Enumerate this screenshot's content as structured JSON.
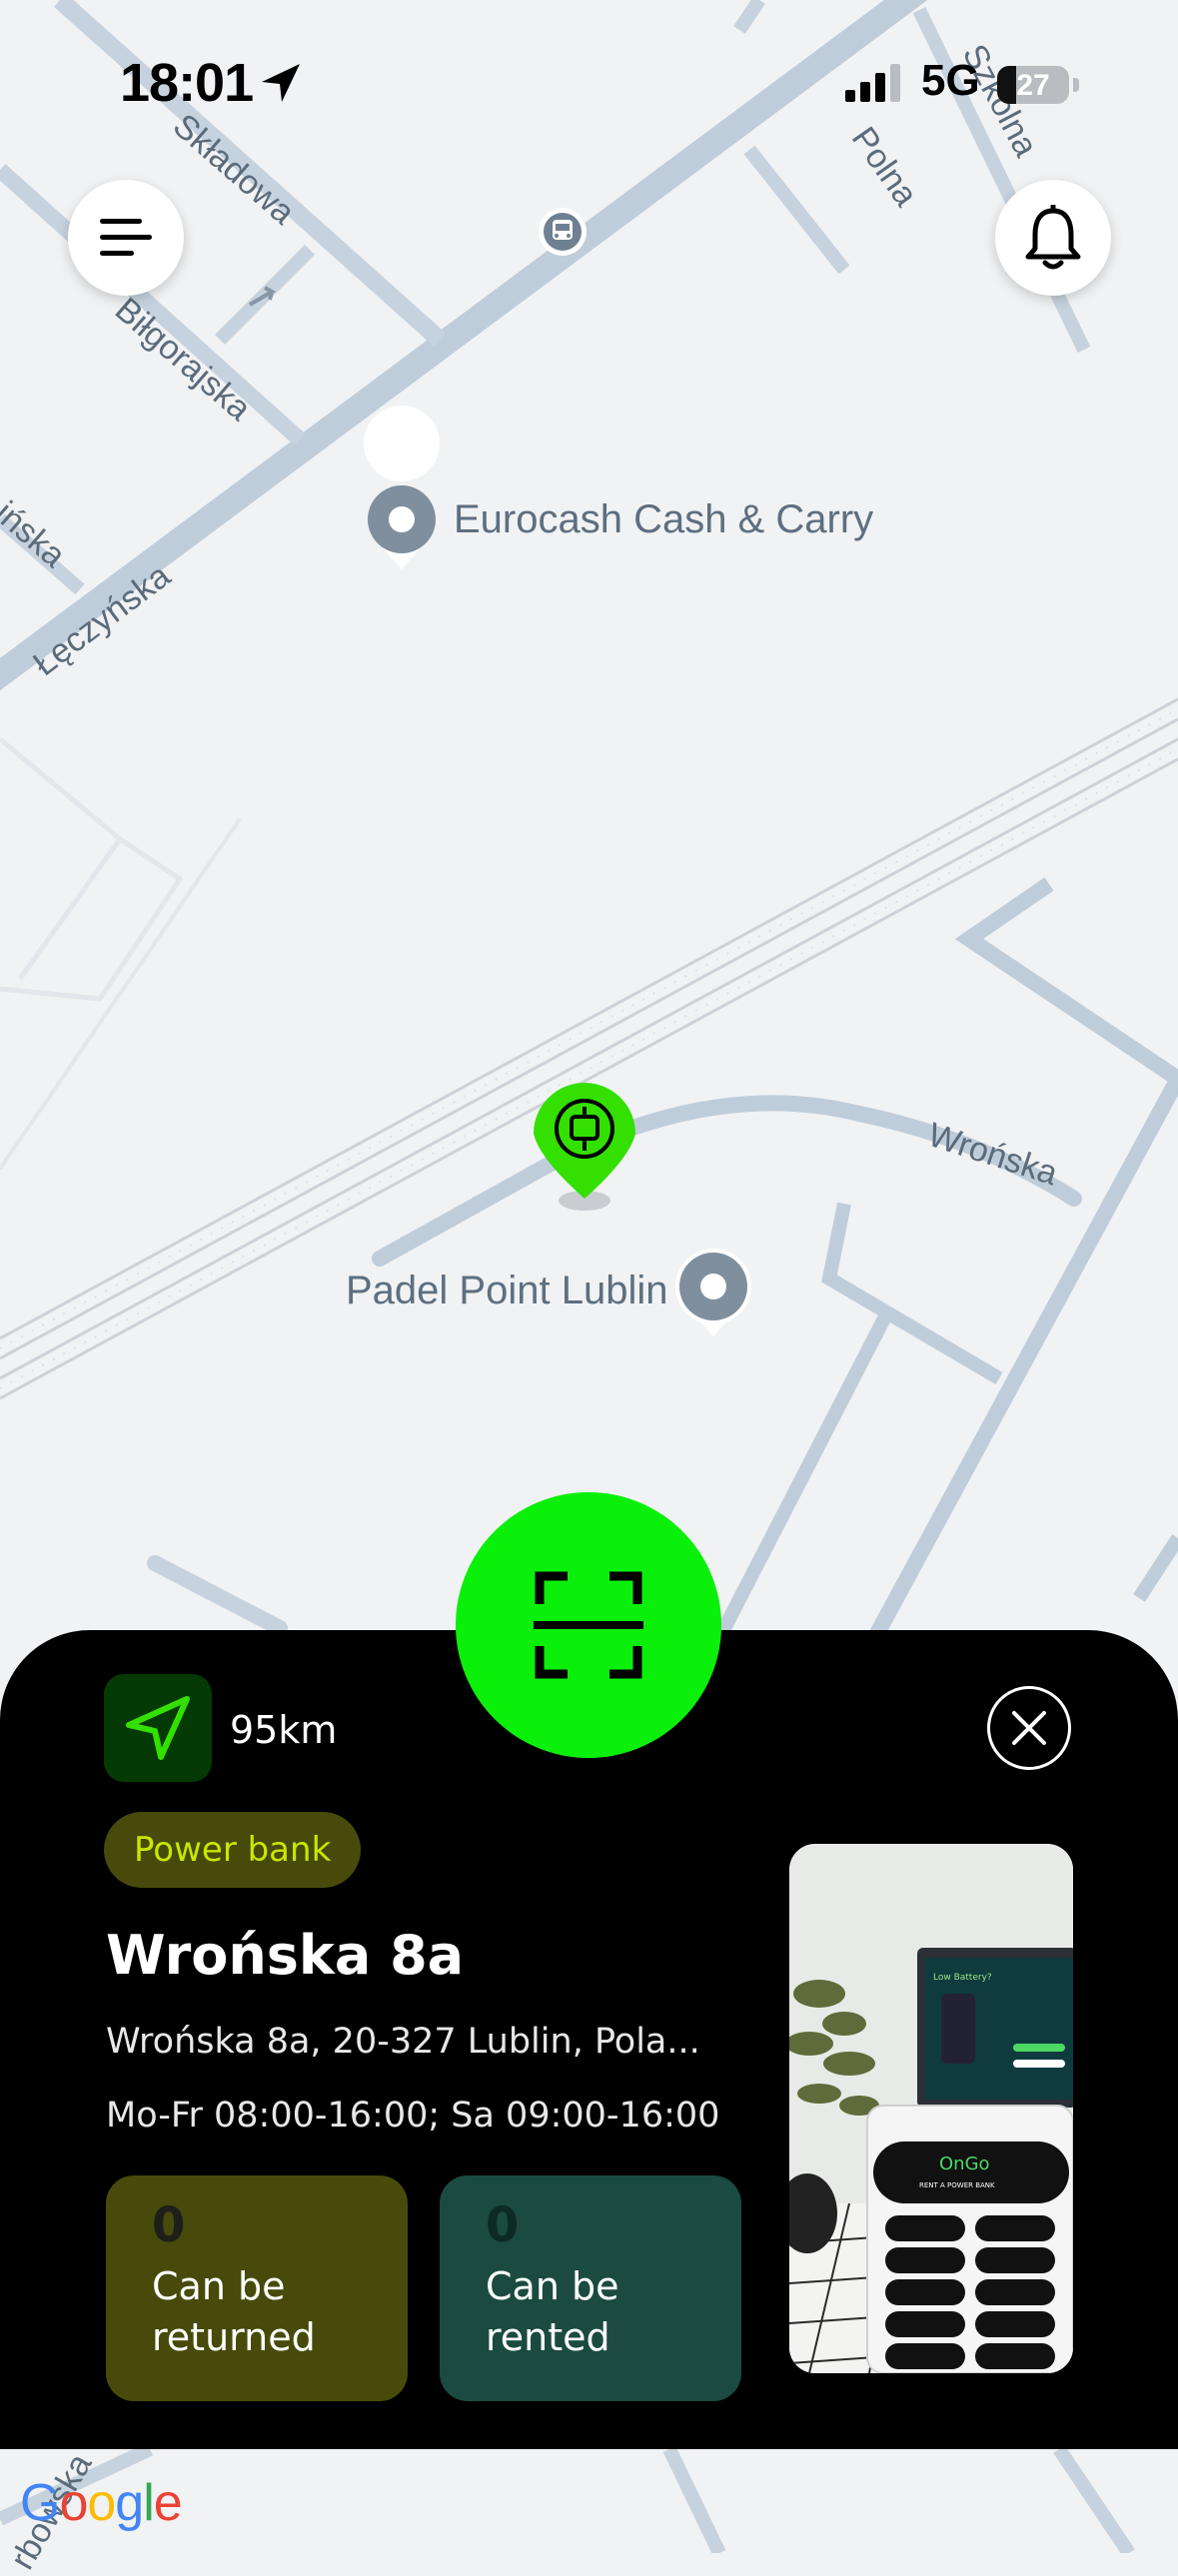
{
  "status_bar": {
    "time": "18:01",
    "network": "5G",
    "battery": "27",
    "battery_level": 0.27
  },
  "map": {
    "poi_labels": [
      "Eurocash Cash & Carry",
      "Padel Point Lublin"
    ],
    "street_labels": [
      "Składowa",
      "Biłgorajska",
      "Łęczyńska",
      "ińska",
      "Polna",
      "Szkolna",
      "Wrońska",
      "rbowska"
    ],
    "logo": "Google"
  },
  "icons": {
    "menu": "hamburger-menu-icon",
    "notifications": "bell-icon",
    "scan": "scan-qr-icon",
    "navigate": "navigation-arrow-icon",
    "close": "close-icon",
    "station_pin": "power-station-pin-icon",
    "poi_pin": "place-pin-icon",
    "bus": "bus-stop-icon"
  },
  "colors": {
    "accent_green": "#0bf00b",
    "pin_green": "#33e000",
    "panel_bg": "#000000",
    "pill_olive": "#474a0a",
    "pill_text": "#c7e800",
    "teal_card": "#1b4a40"
  },
  "station_panel": {
    "distance": "95km",
    "type": "Power bank",
    "title": "Wrońska 8a",
    "address": "Wrońska 8a, 20-327 Lublin, Pola...",
    "hours": "Mo-Fr 08:00-16:00; Sa 09:00-16:00",
    "stats": [
      {
        "value": "0",
        "label": "Can be returned"
      },
      {
        "value": "0",
        "label": "Can be rented"
      }
    ],
    "photo": {
      "screen_title": "Low Battery?",
      "brand": "OnGo",
      "tagline": "RENT A POWER BANK"
    }
  }
}
